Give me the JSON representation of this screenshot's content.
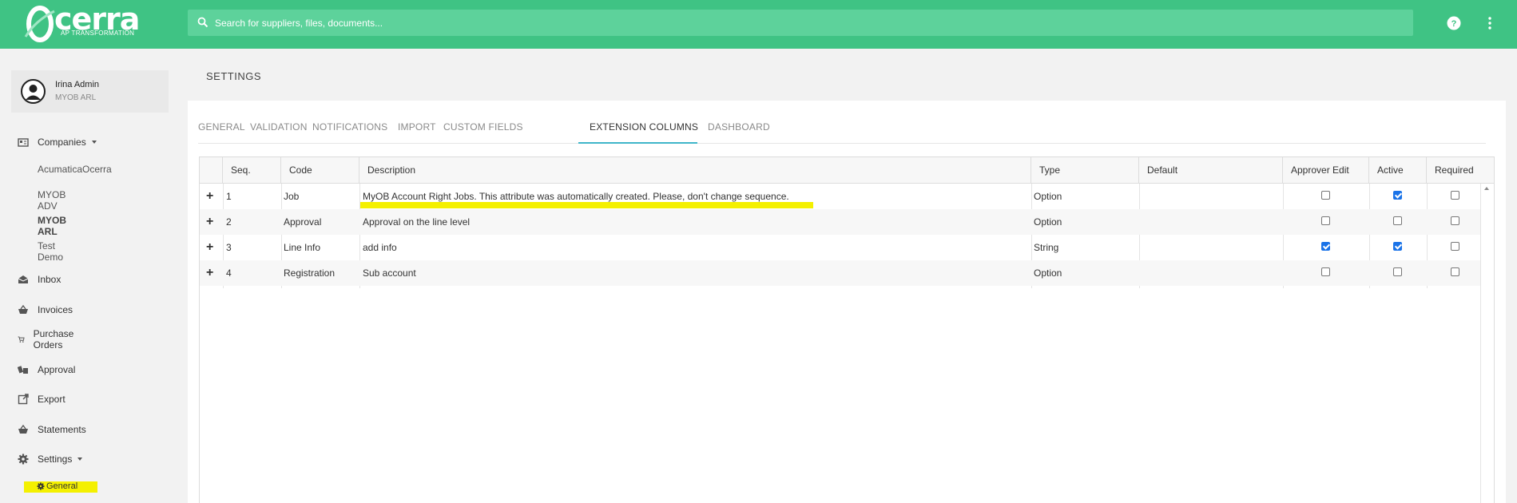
{
  "brand": {
    "name": "cerra",
    "mark": "O",
    "tagline": "AP TRANSFORMATION",
    "accent": "#3fc384"
  },
  "search": {
    "placeholder": "Search for suppliers, files, documents..."
  },
  "user": {
    "name": "Irina Admin",
    "org": "MYOB ARL"
  },
  "nav": {
    "companies": "Companies",
    "company_list": [
      "AcumaticaOcerra",
      "MYOB ADV",
      "MYOB ARL",
      "Test Demo"
    ],
    "inbox": "Inbox",
    "invoices": "Invoices",
    "purchase_orders": "Purchase Orders",
    "approval": "Approval",
    "export": "Export",
    "statements": "Statements",
    "settings": "Settings",
    "general": "General"
  },
  "page": {
    "title": "SETTINGS"
  },
  "tabs": [
    "GENERAL",
    "VALIDATION",
    "NOTIFICATIONS",
    "IMPORT",
    "CUSTOM FIELDS",
    "EXTENSION COLUMNS",
    "DASHBOARD"
  ],
  "active_tab": "EXTENSION COLUMNS",
  "table": {
    "headers": [
      "Seq.",
      "Code",
      "Description",
      "Type",
      "Default",
      "Approver Edit",
      "Active",
      "Required"
    ],
    "rows": [
      {
        "seq": "1",
        "code": "Job",
        "description": "MyOB Account Right Jobs. This attribute was automatically created. Please, don't change sequence.",
        "type": "Option",
        "default": "",
        "approver_edit": false,
        "active": true,
        "required": false
      },
      {
        "seq": "2",
        "code": "Approval",
        "description": "Approval on the line level",
        "type": "Option",
        "default": "",
        "approver_edit": false,
        "active": false,
        "required": false
      },
      {
        "seq": "3",
        "code": "Line Info",
        "description": "add info",
        "type": "String",
        "default": "",
        "approver_edit": true,
        "active": true,
        "required": false
      },
      {
        "seq": "4",
        "code": "Registration",
        "description": "Sub account",
        "type": "Option",
        "default": "",
        "approver_edit": false,
        "active": false,
        "required": false
      }
    ]
  }
}
